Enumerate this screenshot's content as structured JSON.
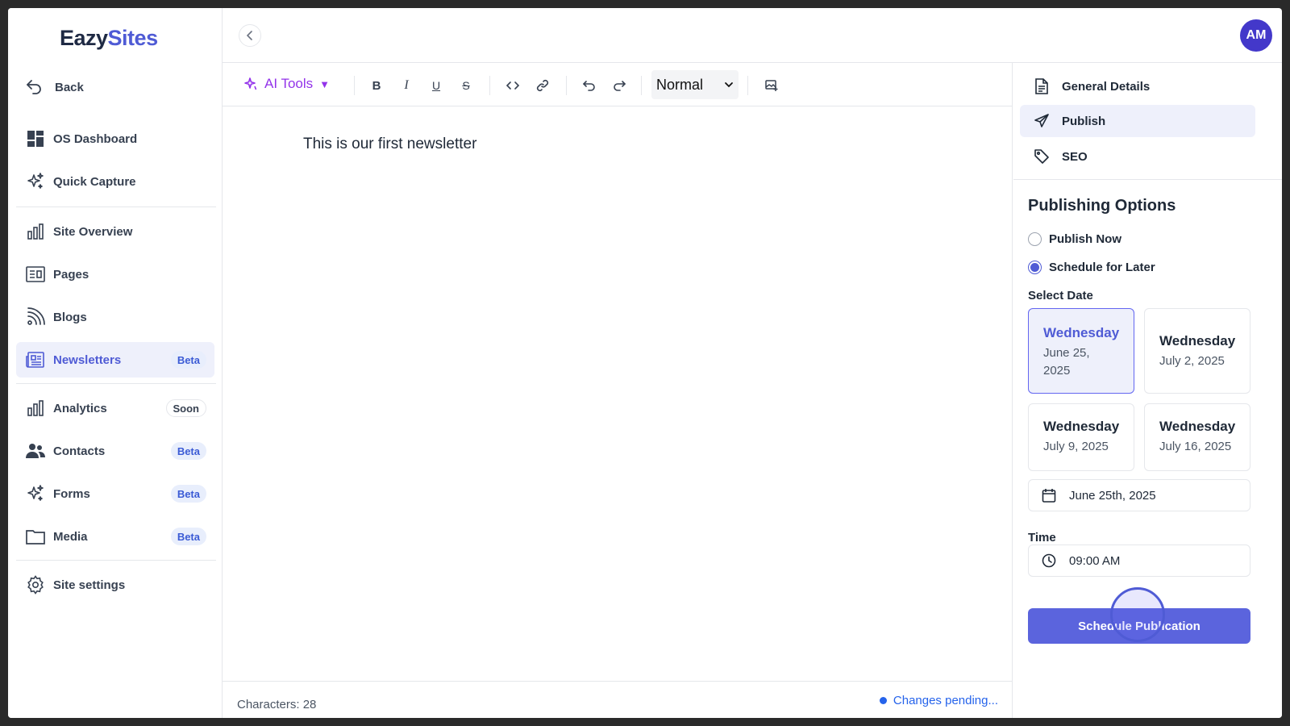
{
  "brand": {
    "part1": "Eazy",
    "part2": "Sites"
  },
  "sidebar": {
    "back": "Back",
    "items": [
      {
        "label": "OS Dashboard",
        "icon": "grid-icon"
      },
      {
        "label": "Quick Capture",
        "icon": "sparkle-icon"
      },
      {
        "label": "Site Overview",
        "icon": "bar-chart-icon"
      },
      {
        "label": "Pages",
        "icon": "pages-icon"
      },
      {
        "label": "Blogs",
        "icon": "rss-icon"
      },
      {
        "label": "Newsletters",
        "icon": "newspaper-icon",
        "badge": "Beta",
        "active": true
      },
      {
        "label": "Analytics",
        "icon": "bar-chart-icon",
        "badge": "Soon"
      },
      {
        "label": "Contacts",
        "icon": "users-icon",
        "badge": "Beta"
      },
      {
        "label": "Forms",
        "icon": "sparkle-icon",
        "badge": "Beta"
      },
      {
        "label": "Media",
        "icon": "folder-icon",
        "badge": "Beta"
      },
      {
        "label": "Site settings",
        "icon": "gear-icon"
      }
    ]
  },
  "header": {
    "avatar": "AM"
  },
  "editor": {
    "ai_tools": "AI Tools",
    "format_select": "Normal",
    "content": "This is our first newsletter",
    "characters": "Characters: 28",
    "status": "Changes pending..."
  },
  "panel": {
    "tabs": [
      {
        "label": "General Details",
        "icon": "document-icon"
      },
      {
        "label": "Publish",
        "icon": "send-icon",
        "active": true
      },
      {
        "label": "SEO",
        "icon": "tag-icon"
      }
    ],
    "title": "Publishing Options",
    "options": [
      {
        "label": "Publish Now",
        "checked": false
      },
      {
        "label": "Schedule for Later",
        "checked": true
      }
    ],
    "select_date_label": "Select Date",
    "dates": [
      {
        "day": "Wednesday",
        "date": "June 25, 2025",
        "selected": true
      },
      {
        "day": "Wednesday",
        "date": "July 2, 2025",
        "selected": false
      },
      {
        "day": "Wednesday",
        "date": "July 9, 2025",
        "selected": false
      },
      {
        "day": "Wednesday",
        "date": "July 16, 2025",
        "selected": false
      }
    ],
    "date_value": "June 25th, 2025",
    "time_label": "Time",
    "time_value": "09:00 AM",
    "button": "Schedule Publication"
  },
  "colors": {
    "accent": "#4f5bd5",
    "ai": "#9333ea",
    "avatar": "#4338ca"
  }
}
